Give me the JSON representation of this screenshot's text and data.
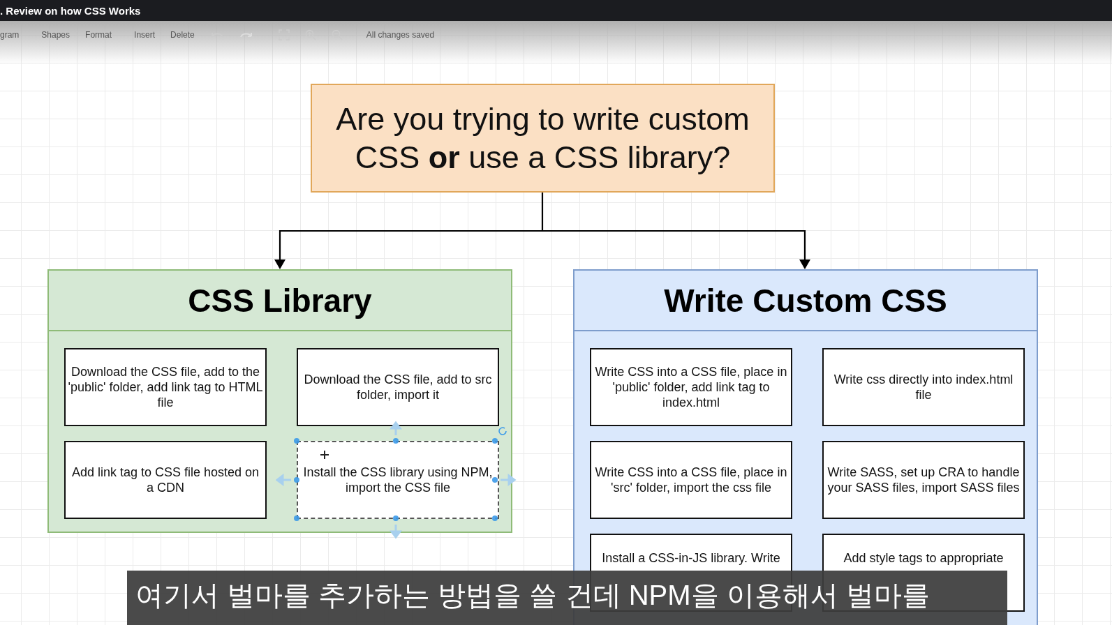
{
  "title_bar": {
    "title": ". Review on how CSS Works"
  },
  "toolbar": {
    "items": [
      "gram",
      "Shapes",
      "Format",
      "Insert",
      "Delete"
    ],
    "status": "All changes saved"
  },
  "question": {
    "text": "Are you trying to write custom CSS **or** use a CSS library?"
  },
  "containers": [
    {
      "kind": "library",
      "title": "CSS Library",
      "boxes": [
        {
          "text": "Download the CSS file, add to the 'public' folder, add link tag to HTML file",
          "selected": false
        },
        {
          "text": "Download the CSS file, add to src folder, import it",
          "selected": false
        },
        {
          "text": "Add link tag to CSS file hosted on a CDN",
          "selected": false
        },
        {
          "text": "Install the CSS library using NPM, import the CSS file",
          "selected": true
        }
      ]
    },
    {
      "kind": "custom",
      "title": "Write Custom CSS",
      "boxes": [
        {
          "text": "Write CSS into a CSS file, place in 'public' folder, add link tag to index.html",
          "selected": false
        },
        {
          "text": "Write css directly into index.html file",
          "selected": false
        },
        {
          "text": "Write CSS into a CSS file, place in 'src' folder, import the css file",
          "selected": false
        },
        {
          "text": "Write SASS, set up CRA to handle your SASS files, import SASS files",
          "selected": false
        },
        {
          "text": "Install a CSS-in-JS library. Write",
          "selected": false
        },
        {
          "text": "Add style tags to appropriate",
          "selected": false
        }
      ]
    }
  ],
  "subtitle": {
    "text": "여기서 벌마를 추가하는 방법을 쓸 건데 NPM을 이용해서 벌마를"
  }
}
